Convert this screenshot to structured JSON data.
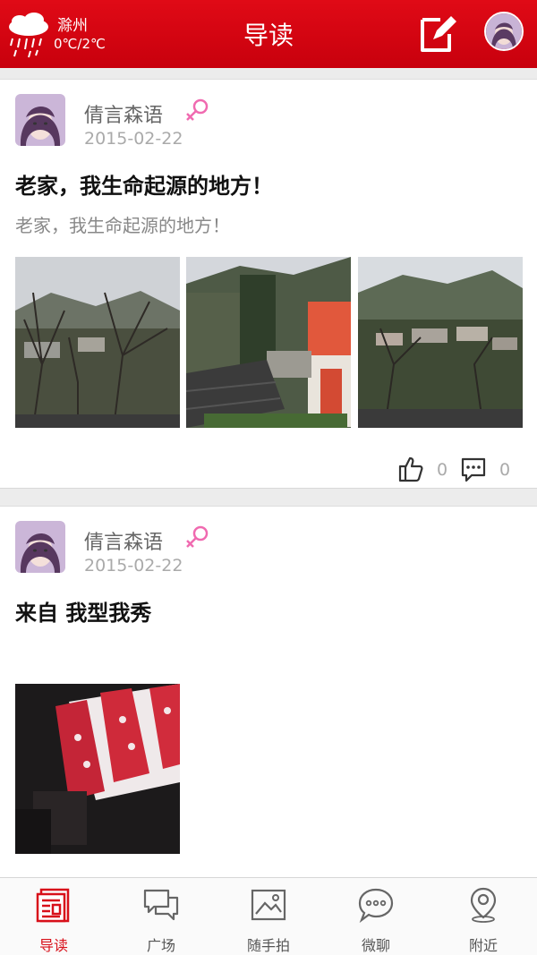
{
  "colors": {
    "brand": "#d40712",
    "gender_female": "#f06ab0",
    "muted_text": "#aaaaaa"
  },
  "header": {
    "weather": {
      "city": "滁州",
      "temp": "0℃/2℃",
      "icon": "rain-cloud-icon"
    },
    "title": "导读",
    "edit_icon": "edit-icon",
    "avatar_icon": "avatar"
  },
  "posts": [
    {
      "author": "倩言森语",
      "gender_icon": "female-icon",
      "date": "2015-02-22",
      "title": "老家，我生命起源的地方！",
      "body": "老家，我生命起源的地方！",
      "photos": [
        "mountain-village-photo",
        "courtyard-photo",
        "hillside-village-photo"
      ],
      "likes": "0",
      "comments": "0"
    },
    {
      "author": "倩言森语",
      "gender_icon": "female-icon",
      "date": "2015-02-22",
      "title": "来自 我型我秀",
      "photos": [
        "room-curtain-photo"
      ]
    }
  ],
  "nav": [
    {
      "label": "导读",
      "icon": "news-icon",
      "active": true
    },
    {
      "label": "广场",
      "icon": "chat-bubbles-icon",
      "active": false
    },
    {
      "label": "随手拍",
      "icon": "image-icon",
      "active": false
    },
    {
      "label": "微聊",
      "icon": "message-dots-icon",
      "active": false
    },
    {
      "label": "附近",
      "icon": "location-pin-icon",
      "active": false
    }
  ]
}
